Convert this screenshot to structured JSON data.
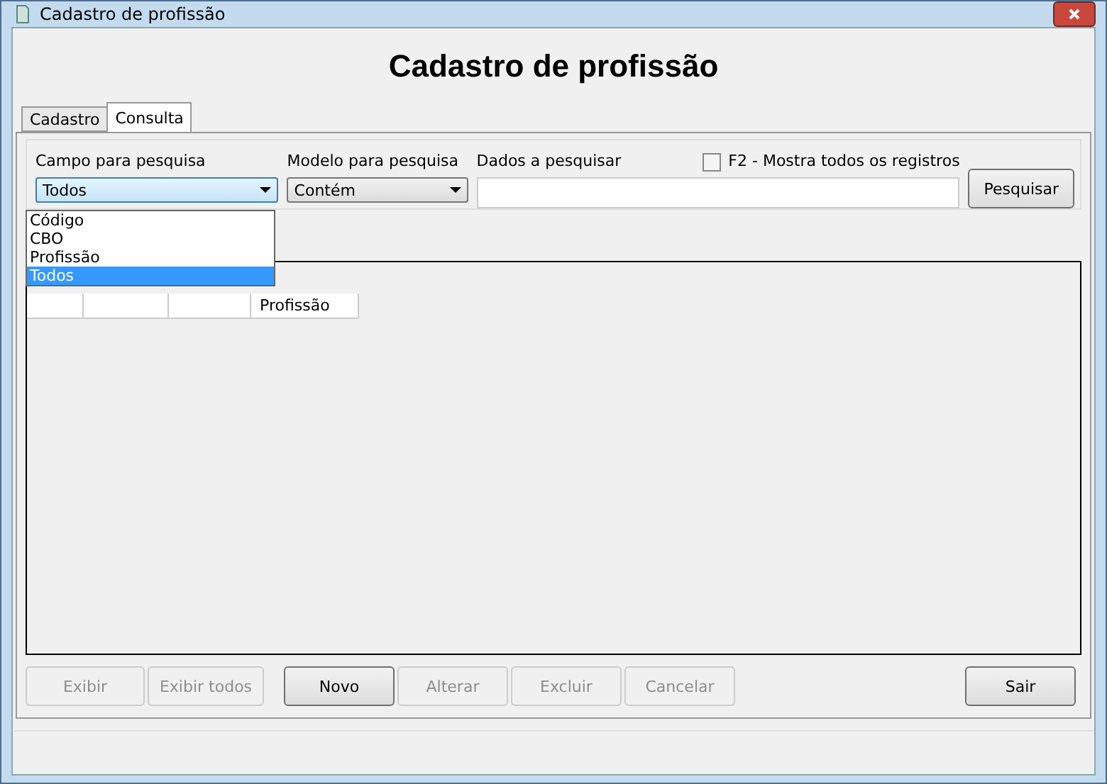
{
  "window": {
    "title": "Cadastro de profissão"
  },
  "heading": "Cadastro de profissão",
  "tabs": [
    {
      "label": "Cadastro",
      "selected": false
    },
    {
      "label": "Consulta",
      "selected": true
    }
  ],
  "search": {
    "field_label": "Campo para pesquisa",
    "field_value": "Todos",
    "field_options": [
      {
        "label": "Código",
        "selected": false
      },
      {
        "label": "CBO",
        "selected": false
      },
      {
        "label": "Profissão",
        "selected": false
      },
      {
        "label": "Todos",
        "selected": true
      }
    ],
    "model_label": "Modelo para pesquisa",
    "model_value": "Contém",
    "data_label": "Dados a pesquisar",
    "show_all_label": "F2 - Mostra todos os registros",
    "show_all_checked": false,
    "search_button": "Pesquisar"
  },
  "table": {
    "columns": [
      {
        "label": "Profissão"
      }
    ]
  },
  "buttons": [
    {
      "label": "Exibir",
      "disabled": true
    },
    {
      "label": "Exibir todos",
      "disabled": true
    },
    {
      "label": "Novo",
      "disabled": false
    },
    {
      "label": "Alterar",
      "disabled": true
    },
    {
      "label": "Excluir",
      "disabled": true
    },
    {
      "label": "Cancelar",
      "disabled": true
    }
  ],
  "exit_button": "Sair"
}
